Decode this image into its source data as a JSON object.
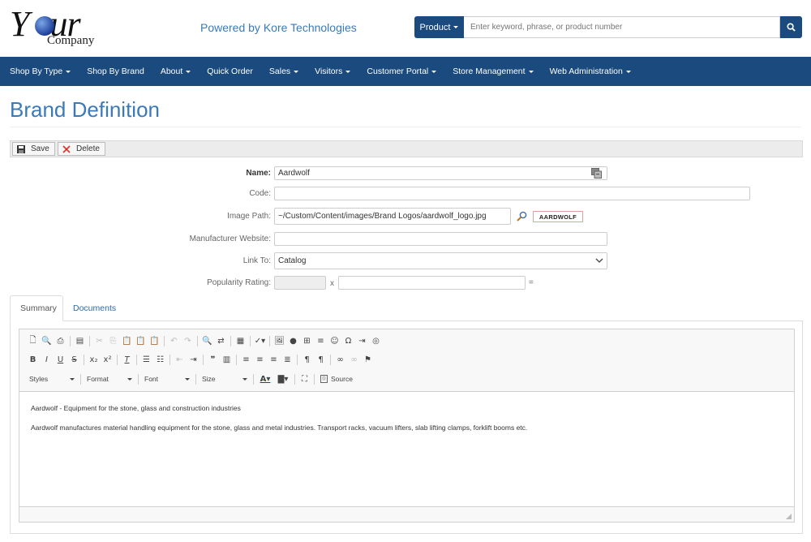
{
  "header": {
    "logo_your": "Y",
    "logo_ur": "ur",
    "logo_company": "Company",
    "powered_by": "Powered by Kore Technologies",
    "search_scope": "Product",
    "search_placeholder": "Enter keyword, phrase, or product number"
  },
  "nav": {
    "items": [
      {
        "label": "Shop By Type",
        "dropdown": true
      },
      {
        "label": "Shop By Brand",
        "dropdown": false
      },
      {
        "label": "About",
        "dropdown": true
      },
      {
        "label": "Quick Order",
        "dropdown": false
      },
      {
        "label": "Sales",
        "dropdown": true
      },
      {
        "label": "Visitors",
        "dropdown": true
      },
      {
        "label": "Customer Portal",
        "dropdown": true
      },
      {
        "label": "Store Management",
        "dropdown": true
      },
      {
        "label": "Web Administration",
        "dropdown": true
      }
    ]
  },
  "page": {
    "title": "Brand Definition"
  },
  "toolbar": {
    "save_label": "Save",
    "delete_label": "Delete"
  },
  "form": {
    "name_label": "Name:",
    "name_value": "Aardwolf",
    "code_label": "Code:",
    "code_value": "",
    "image_path_label": "Image Path:",
    "image_path_value": "~/Custom/Content/images/Brand Logos/aardwolf_logo.jpg",
    "brand_logo_text": "AARDWOLF",
    "manufacturer_website_label": "Manufacturer Website:",
    "manufacturer_website_value": "",
    "link_to_label": "Link To:",
    "link_to_value": "Catalog",
    "popularity_label": "Popularity Rating:",
    "popularity_value": "",
    "popularity_multiplier_value": "",
    "popularity_x": "x",
    "popularity_equals": "="
  },
  "tabs": {
    "summary": "Summary",
    "documents": "Documents"
  },
  "editor": {
    "styles_label": "Styles",
    "format_label": "Format",
    "font_label": "Font",
    "size_label": "Size",
    "source_label": "Source",
    "content": [
      "Aardwolf - Equipment for the stone, glass and construction industries",
      "Aardwolf manufactures material handling equipment for the stone, glass and metal industries. Transport racks, vacuum lifters, slab lifting clamps, forklift booms etc."
    ]
  },
  "colors": {
    "brand_blue": "#1a4a7e",
    "title_blue": "#3a7ab8",
    "delete_red": "#d9302a"
  }
}
